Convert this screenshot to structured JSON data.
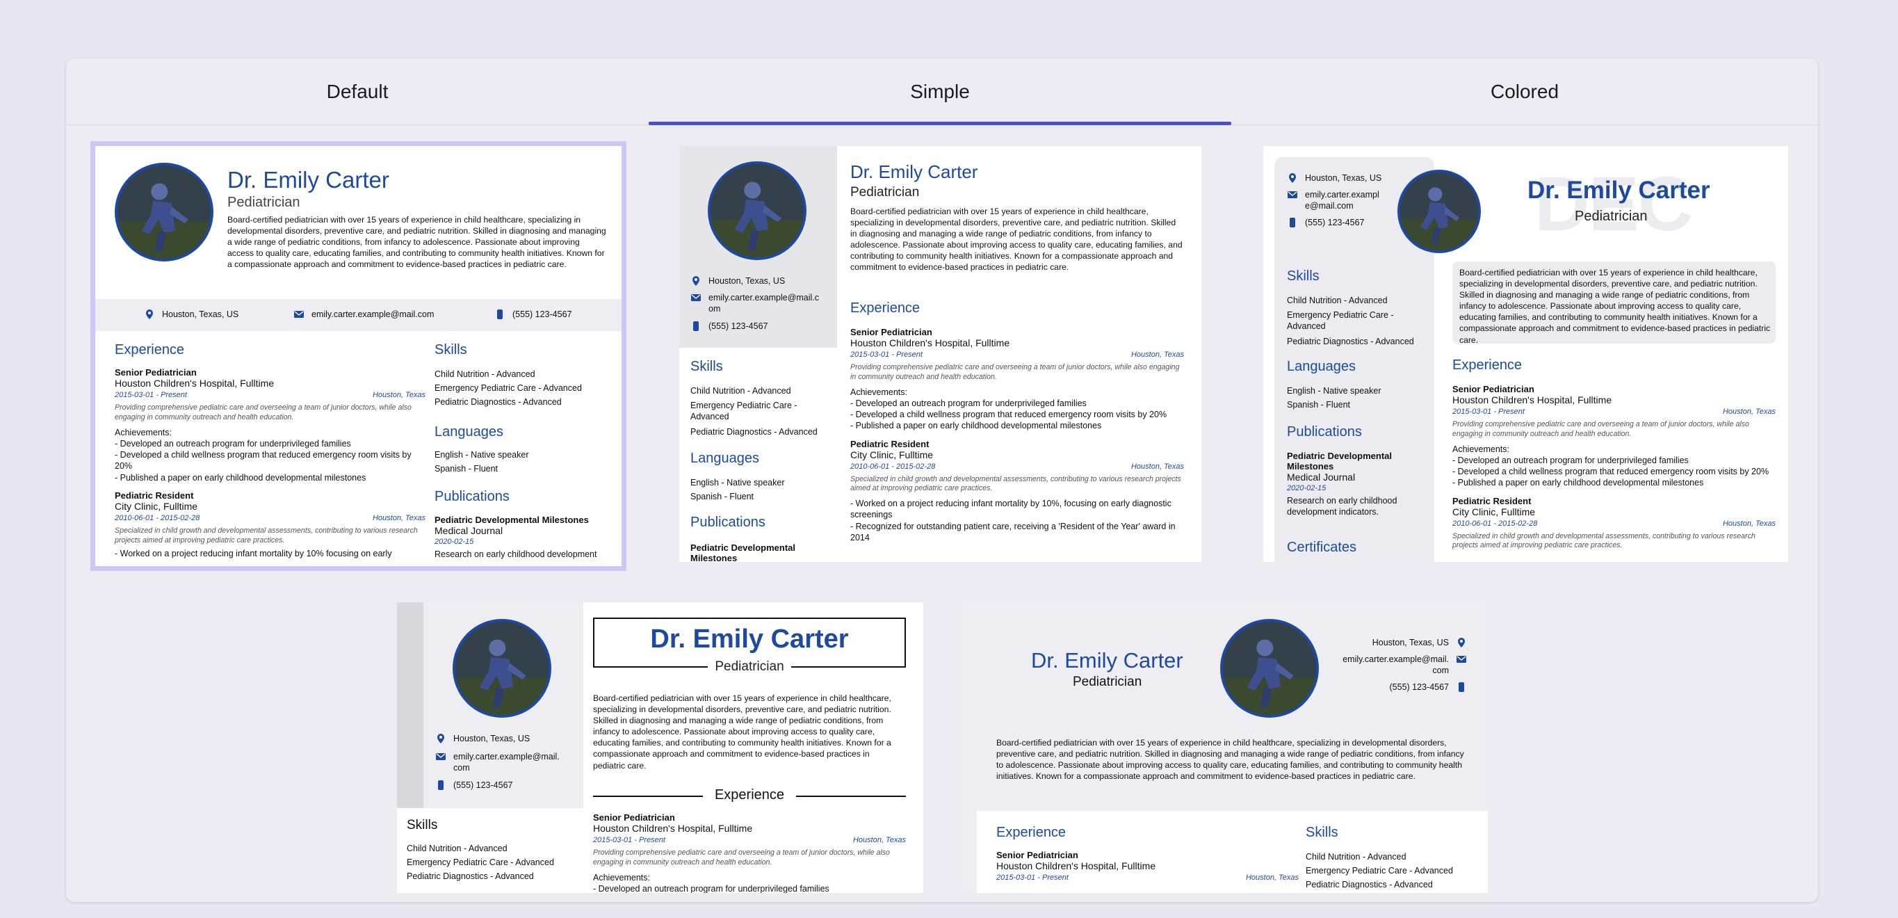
{
  "tabs": [
    "Default",
    "Simple",
    "Colored"
  ],
  "resume": {
    "name": "Dr. Emily Carter",
    "profession": "Pediatrician",
    "summary": "Board-certified pediatrician with over 15 years of experience in child healthcare, specializing in developmental disorders, preventive care, and pediatric nutrition. Skilled in diagnosing and managing a wide range of pediatric conditions, from infancy to adolescence. Passionate about improving access to quality care, educating families, and contributing to community health initiatives. Known for a compassionate approach and commitment to evidence-based practices in pediatric care.",
    "location": "Houston, Texas, US",
    "email": "emily.carter.example@mail.com",
    "email_wrap_a": "emily.carter.example@mail.c",
    "email_wrap_b": "om",
    "email_wrap2_a": "emily.carter.exampl",
    "email_wrap2_b": "e@mail.com",
    "email_wrap3_a": "emily.carter.example@mail.",
    "email_wrap3_b": "com",
    "phone": "(555) 123-4567",
    "monogram": "DEC",
    "sections": {
      "experience": "Experience",
      "skills": "Skills",
      "languages": "Languages",
      "publications": "Publications",
      "certificates": "Certificates"
    },
    "jobs": [
      {
        "title": "Senior Pediatrician",
        "company": "Houston Children's Hospital, Fulltime",
        "dates": "2015-03-01 - Present",
        "location": "Houston, Texas",
        "description": "Providing comprehensive pediatric care and overseeing a team of junior doctors, while also engaging in community outreach and health education.",
        "achievements_label": "Achievements:",
        "achievements": [
          "- Developed an outreach program for underprivileged families",
          "- Developed a child wellness program that reduced emergency room visits by 20%",
          "- Published a paper on early childhood developmental milestones"
        ]
      },
      {
        "title": "Pediatric Resident",
        "company": "City Clinic, Fulltime",
        "dates": "2010-06-01 - 2015-02-28",
        "location": "Houston, Texas",
        "description": "Specialized in child growth and developmental assessments, contributing to various research projects aimed at improving pediatric care practices.",
        "achievements": [
          "- Worked on a project reducing infant mortality by 10%, focusing on early diagnostic screenings",
          "- Recognized for outstanding patient care, receiving a 'Resident of the Year' award in 2014"
        ],
        "cut_line": "- Worked on a project reducing infant mortality by 10% focusing on early"
      }
    ],
    "skills": [
      "Child Nutrition - Advanced",
      "Emergency Pediatric Care - Advanced",
      "Pediatric Diagnostics - Advanced"
    ],
    "languages": [
      "English - Native speaker",
      "Spanish - Fluent"
    ],
    "publication": {
      "title": "Pediatric Developmental Milestones",
      "journal": "Medical Journal",
      "date": "2020-02-15",
      "summary": "Research on early childhood development indicators.",
      "summary_cut": "Research on early childhood development"
    }
  },
  "colors": {
    "accent": "#1d4aa0",
    "tab_indicator": "#4950d4",
    "selected_outline": "#c9c8f6",
    "sidebar_gray": "#e6e6e9",
    "contact_bar": "#eeeef2"
  },
  "icons": [
    "location-icon",
    "email-icon",
    "phone-icon"
  ]
}
